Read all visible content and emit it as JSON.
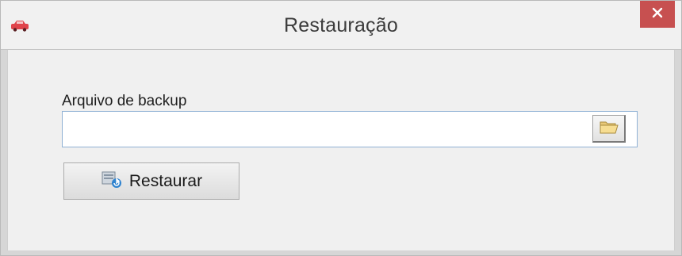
{
  "window": {
    "title": "Restauração",
    "app_icon": "red-car-icon",
    "close_icon": "close-icon",
    "close_color": "#c75050"
  },
  "form": {
    "label": "Arquivo de backup",
    "file_value": "",
    "file_placeholder": "",
    "browse_icon": "folder-open-icon",
    "restore_label": "Restaurar",
    "restore_icon": "restore-database-icon"
  }
}
